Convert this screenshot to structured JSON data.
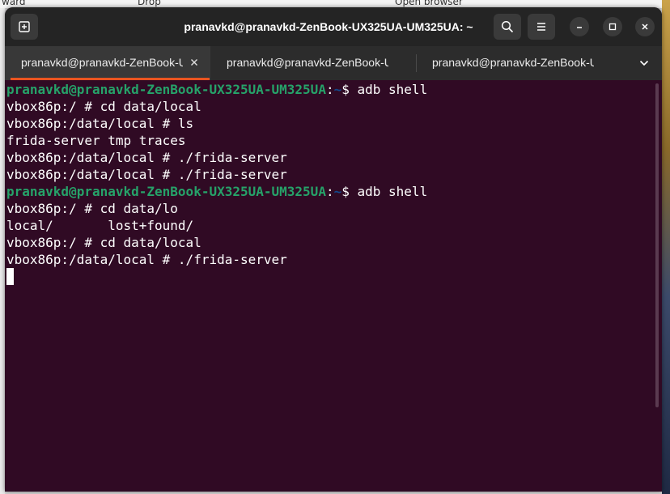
{
  "background_window": {
    "items": [
      "ward",
      "Drop",
      "Open browser"
    ]
  },
  "window": {
    "title": "pranavkd@pranavkd-ZenBook-UX325UA-UM325UA: ~",
    "buttons": {
      "new_tab_icon": "new-tab-icon",
      "search_icon": "search-icon",
      "menu_icon": "hamburger-menu-icon",
      "minimize_icon": "minimize-icon",
      "maximize_icon": "maximize-icon",
      "close_icon": "close-icon"
    }
  },
  "tabs": [
    {
      "label": "pranavkd@pranavkd-ZenBook-UX325UA-UM325UA: ~",
      "active": true
    },
    {
      "label": "pranavkd@pranavkd-ZenBook-UX325UA-UM325UA: ~",
      "active": false
    },
    {
      "label": "pranavkd@pranavkd-ZenBook-UX325UA-UM325UA: ~",
      "active": false
    }
  ],
  "terminal": {
    "lines": [
      {
        "kind": "prompt",
        "user": "pranavkd@pranavkd-ZenBook-UX325UA-UM325UA",
        "path": "~",
        "cmd": "adb shell"
      },
      {
        "kind": "text",
        "text": "vbox86p:/ # cd data/local"
      },
      {
        "kind": "text",
        "text": "vbox86p:/data/local # ls"
      },
      {
        "kind": "text",
        "text": "frida-server tmp traces"
      },
      {
        "kind": "text",
        "text": "vbox86p:/data/local # ./frida-server"
      },
      {
        "kind": "text",
        "text": "vbox86p:/data/local # ./frida-server"
      },
      {
        "kind": "prompt",
        "user": "pranavkd@pranavkd-ZenBook-UX325UA-UM325UA",
        "path": "~",
        "cmd": "adb shell"
      },
      {
        "kind": "text",
        "text": "vbox86p:/ # cd data/lo"
      },
      {
        "kind": "text",
        "text": "local/       lost+found/"
      },
      {
        "kind": "text",
        "text": "vbox86p:/ # cd data/local"
      },
      {
        "kind": "text",
        "text": "vbox86p:/data/local # ./frida-server"
      }
    ]
  },
  "colors": {
    "terminal_bg": "#300a24",
    "prompt_user": "#26a269",
    "prompt_path": "#12488b",
    "active_tab_indicator": "#e95420"
  }
}
